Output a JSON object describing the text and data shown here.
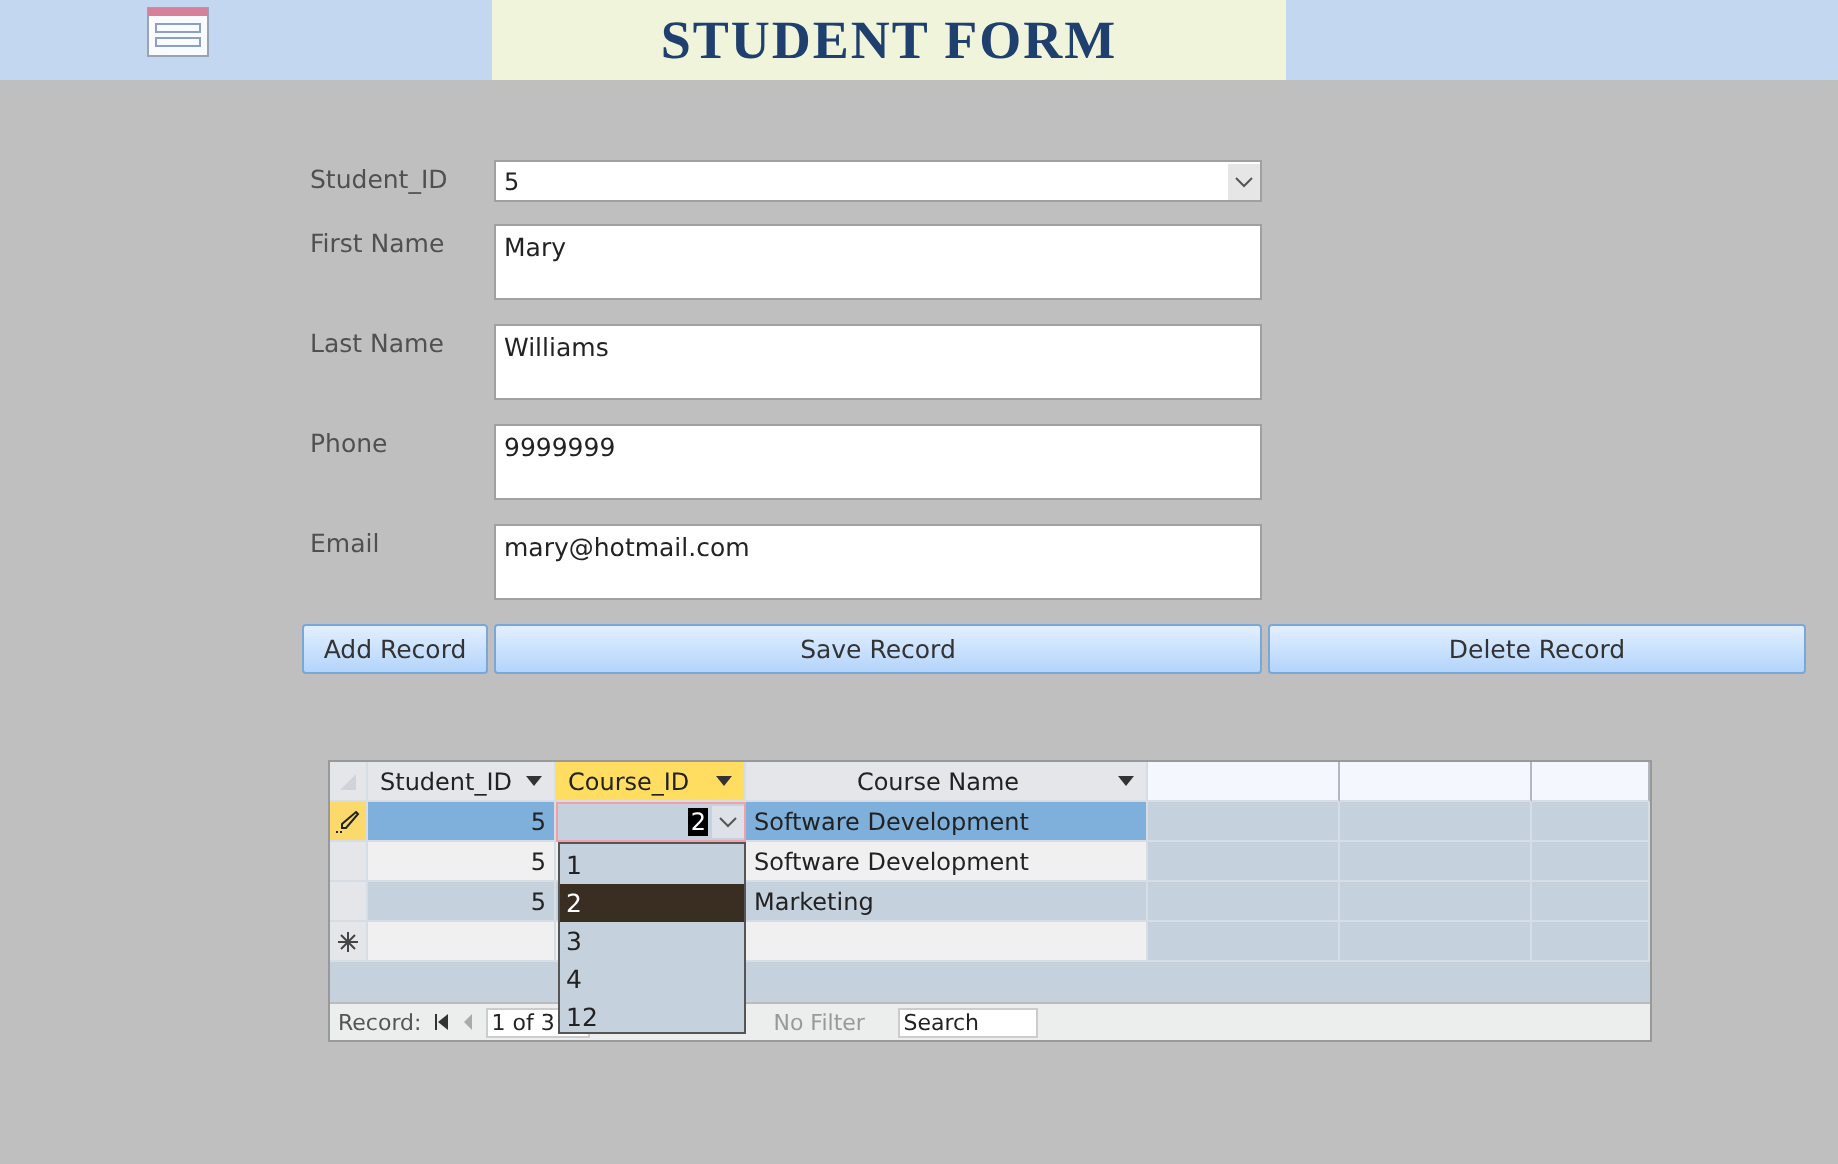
{
  "header": {
    "title": "STUDENT FORM"
  },
  "form": {
    "fields": [
      {
        "label": "Student_ID",
        "value": "5",
        "kind": "combo"
      },
      {
        "label": "First Name",
        "value": "Mary",
        "kind": "text"
      },
      {
        "label": "Last Name",
        "value": "Williams",
        "kind": "text"
      },
      {
        "label": "Phone",
        "value": "9999999",
        "kind": "text"
      },
      {
        "label": "Email",
        "value": "mary@hotmail.com",
        "kind": "text"
      }
    ],
    "buttons": [
      "Add Record",
      "Save Record",
      "Delete Record"
    ]
  },
  "datasheet": {
    "columns": [
      {
        "label": "Student_ID",
        "selected": false
      },
      {
        "label": "Course_ID",
        "selected": true
      },
      {
        "label": "Course Name",
        "selected": false
      }
    ],
    "rows": [
      {
        "student_id": "5",
        "course_id": "2",
        "course_name": "Software Development",
        "selected": true
      },
      {
        "student_id": "5",
        "course_name": "Software Development",
        "selected": false
      },
      {
        "student_id": "5",
        "course_name": "Marketing",
        "selected": false
      }
    ],
    "dropdown": [
      {
        "label": "1",
        "selected": false
      },
      {
        "label": "2",
        "selected": true
      },
      {
        "label": "3",
        "selected": false
      },
      {
        "label": "4",
        "selected": false
      },
      {
        "label": "12",
        "selected": false
      }
    ],
    "navigation": {
      "label": "Record:",
      "position": "1 of 3",
      "filter": "No Filter",
      "search": "Search"
    }
  }
}
